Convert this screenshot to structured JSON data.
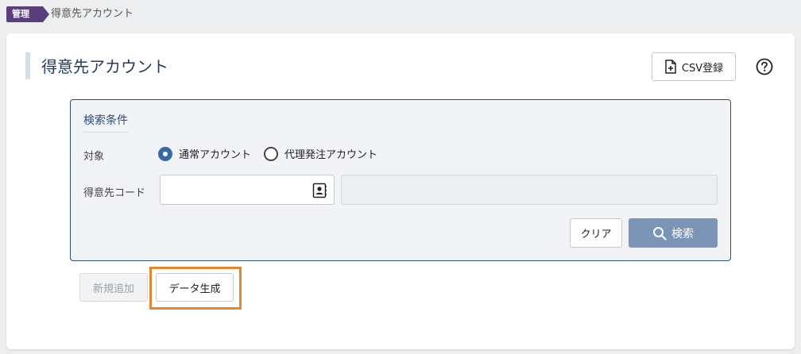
{
  "breadcrumb": {
    "tag": "管理",
    "current": "得意先アカウント"
  },
  "header": {
    "title": "得意先アカウント",
    "csv_button": "CSV登録",
    "help_icon": "question-circle-icon"
  },
  "search": {
    "panel_title": "検索条件",
    "target_label": "対象",
    "options": [
      {
        "label": "通常アカウント",
        "selected": true
      },
      {
        "label": "代理発注アカウント",
        "selected": false
      }
    ],
    "code_label": "得意先コード",
    "code_value": "",
    "code_placeholder": "",
    "name_value": "",
    "clear_button": "クリア",
    "search_button": "検索"
  },
  "actions": {
    "add_button": "新規追加",
    "generate_button": "データ生成"
  },
  "colors": {
    "accent": "#5b3f7d",
    "panel_border": "#2c4e7b",
    "search_button": "#7b95b7",
    "highlight": "#e5872f"
  }
}
